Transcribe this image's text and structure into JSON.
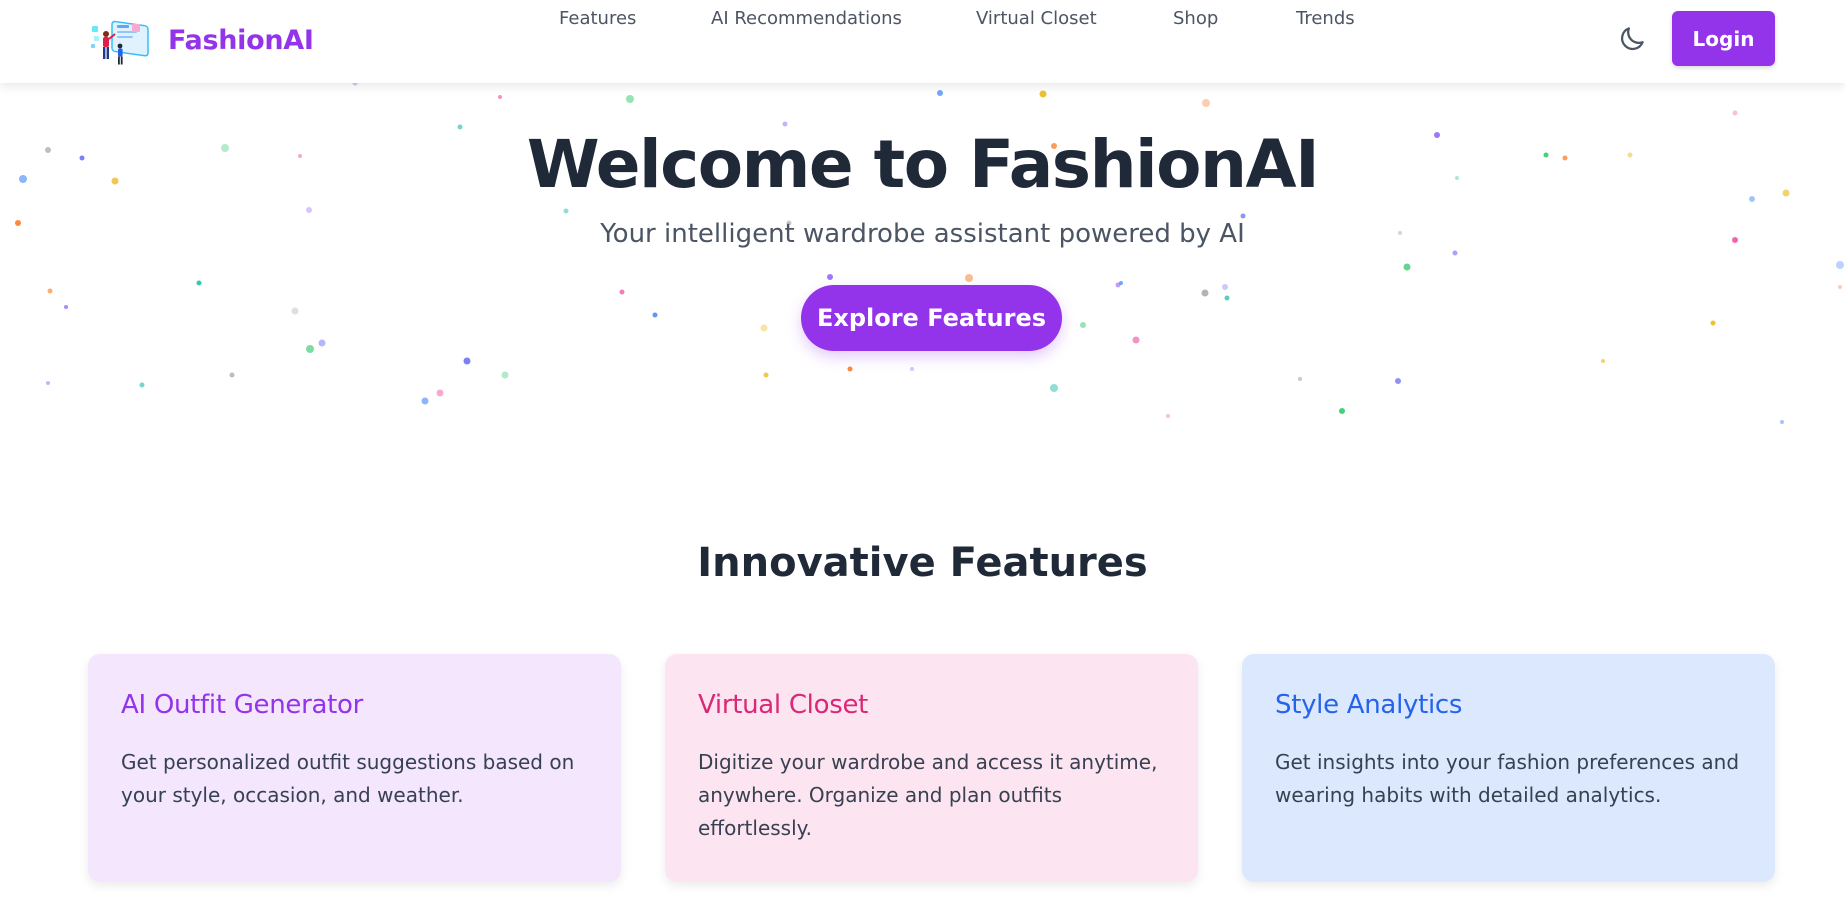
{
  "brand": {
    "name": "FashionAI",
    "logo_icon": "fashion-illustration-logo"
  },
  "nav": {
    "items": [
      {
        "label": "Features"
      },
      {
        "label": "AI Recommendations"
      },
      {
        "label": "Virtual Closet"
      },
      {
        "label": "Shop"
      },
      {
        "label": "Trends"
      }
    ]
  },
  "header": {
    "theme_toggle_icon": "moon-icon",
    "login_label": "Login"
  },
  "hero": {
    "title": "Welcome to FashionAI",
    "subtitle": "Your intelligent wardrobe assistant powered by AI",
    "cta_label": "Explore Features"
  },
  "features": {
    "heading": "Innovative Features",
    "cards": [
      {
        "title": "AI Outfit Generator",
        "description": "Get personalized outfit suggestions based on your style, occasion, and weather.",
        "accent": "#9333ea",
        "background": "#f3e6fd"
      },
      {
        "title": "Virtual Closet",
        "description": "Digitize your wardrobe and access it anytime, anywhere. Organize and plan outfits effortlessly.",
        "accent": "#db2777",
        "background": "#fce5f0"
      },
      {
        "title": "Style Analytics",
        "description": "Get insights into your fashion preferences and wearing habits with detailed analytics.",
        "accent": "#2563eb",
        "background": "#dbe8fd"
      }
    ]
  },
  "colors": {
    "brand_purple": "#9333ea",
    "text_dark": "#1f2937",
    "text_muted": "#4b5563",
    "particle_palette": [
      "#6366f1",
      "#22c55e",
      "#ec4899",
      "#3b82f6",
      "#eab308",
      "#f97316",
      "#8b5cf6",
      "#14b8a6",
      "#a3a3a3"
    ]
  }
}
